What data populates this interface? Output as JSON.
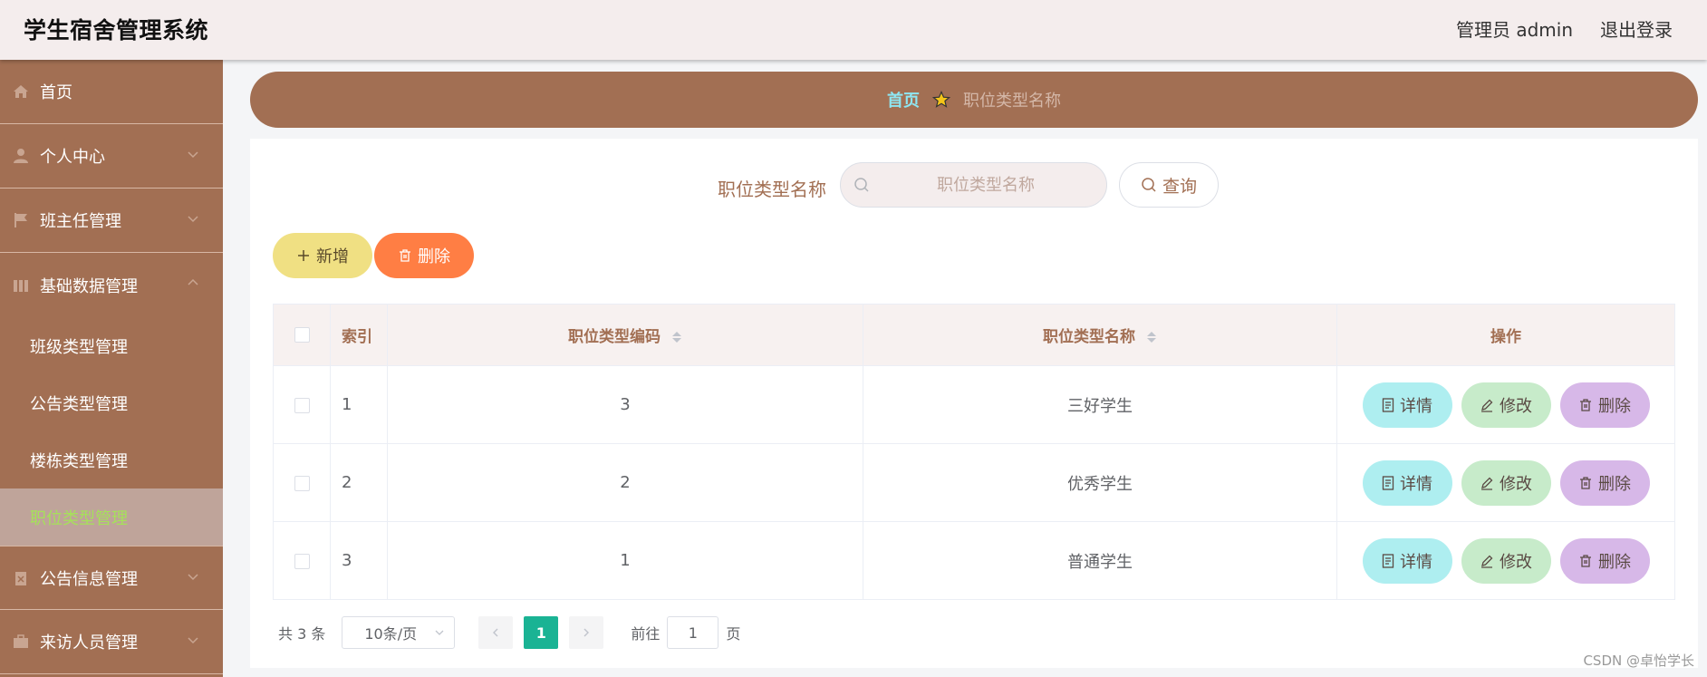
{
  "header": {
    "title": "学生宿舍管理系统",
    "user_label": "管理员 admin",
    "logout_label": "退出登录"
  },
  "sidebar": {
    "items": [
      {
        "label": "首页",
        "icon": "home-icon"
      },
      {
        "label": "个人中心",
        "icon": "user-icon"
      },
      {
        "label": "班主任管理",
        "icon": "flag-icon"
      },
      {
        "label": "基础数据管理",
        "icon": "data-icon"
      },
      {
        "label": "公告信息管理",
        "icon": "clipboard-icon"
      },
      {
        "label": "来访人员管理",
        "icon": "briefcase-icon"
      }
    ],
    "sub_items": [
      {
        "label": "班级类型管理"
      },
      {
        "label": "公告类型管理"
      },
      {
        "label": "楼栋类型管理"
      },
      {
        "label": "职位类型管理"
      }
    ]
  },
  "breadcrumb": {
    "home": "首页",
    "current": "职位类型名称"
  },
  "search": {
    "label": "职位类型名称",
    "placeholder": "职位类型名称",
    "query_button": "查询"
  },
  "actions": {
    "add_label": "新增",
    "delete_label": "删除"
  },
  "table": {
    "headers": {
      "index": "索引",
      "code": "职位类型编码",
      "name": "职位类型名称",
      "ops": "操作"
    },
    "rows": [
      {
        "index": "1",
        "code": "3",
        "name": "三好学生"
      },
      {
        "index": "2",
        "code": "2",
        "name": "优秀学生"
      },
      {
        "index": "3",
        "code": "1",
        "name": "普通学生"
      }
    ],
    "row_ops": {
      "detail": "详情",
      "edit": "修改",
      "delete": "删除"
    }
  },
  "pagination": {
    "total": "共 3 条",
    "page_size": "10条/页",
    "current_page": "1",
    "goto_prefix": "前往",
    "goto_value": "1",
    "goto_suffix": "页"
  },
  "watermark": "CSDN @卓怡学长",
  "colors": {
    "sidebar_bg": "#a26f53",
    "header_bg": "#f4eded",
    "active_sub_bg": "#bfa49a",
    "active_sub_text": "#a6e15a",
    "add_button": "#f0e083",
    "delete_button": "#ff7e44",
    "detail_button": "#aeeef0",
    "edit_button": "#c7ebca",
    "row_delete_button": "#d7b8e8",
    "page_active": "#1ab394"
  }
}
